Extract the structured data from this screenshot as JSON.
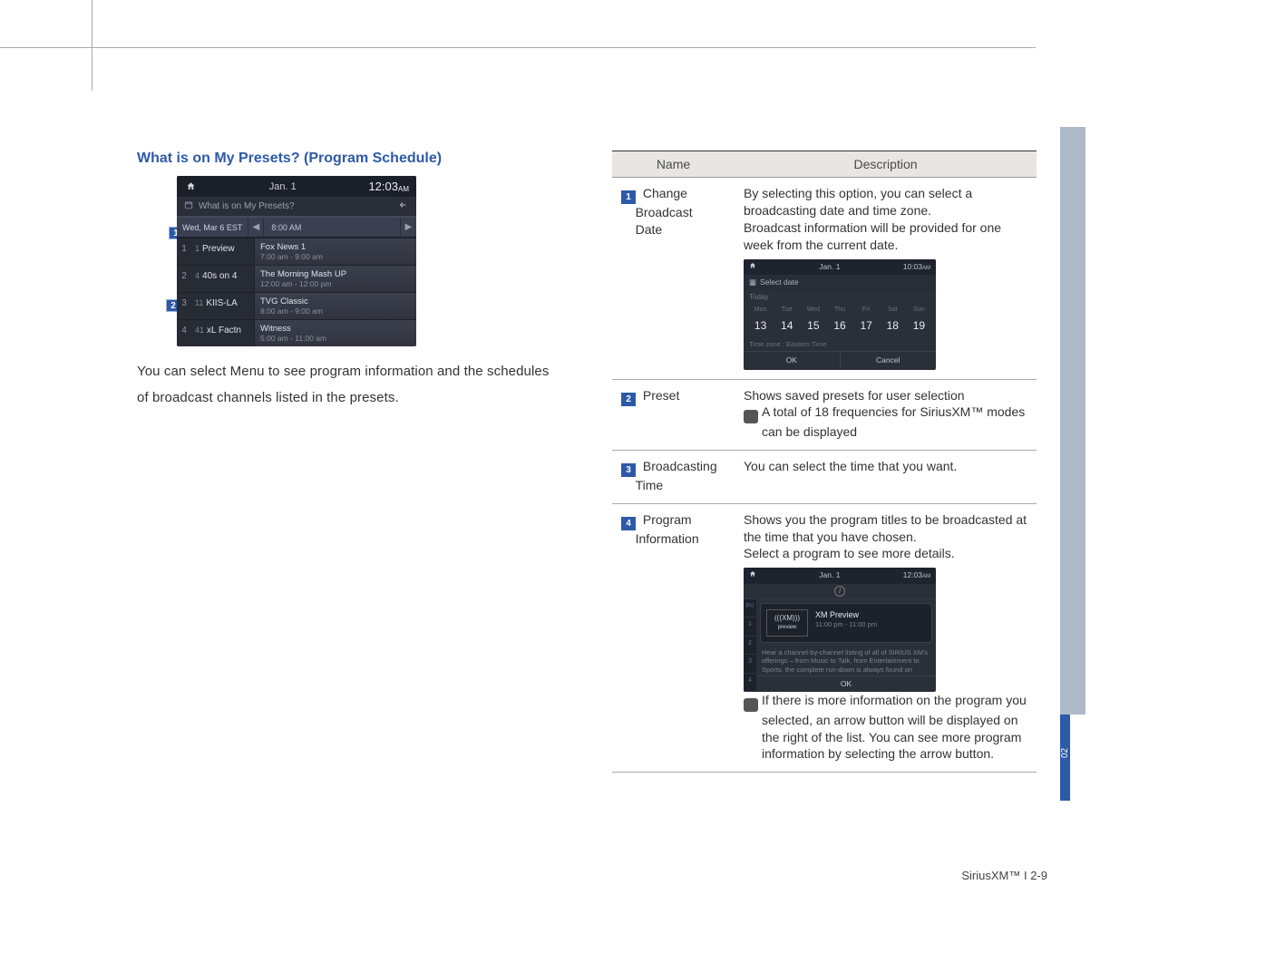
{
  "section_title": "What is on My Presets? (Program Schedule)",
  "body_paragraph": "You can select Menu to see program information and the schedules of broadcast channels listed in the presets.",
  "footer": "SiriusXM™ I 2-9",
  "tab_label": "02",
  "screenshot_main": {
    "date": "Jan.   1",
    "time": "12:03",
    "ampm": "AM",
    "screen_title": "What is on My Presets?",
    "date_selected": "Wed, Mar 6 EST",
    "time_selected": "8:00 AM",
    "rows": [
      {
        "idx": "1",
        "ch": "1",
        "preset": "Preview",
        "title": "Fox News 1",
        "sub": "7:00 am - 9:00 am"
      },
      {
        "idx": "2",
        "ch": "4",
        "preset": "40s on 4",
        "title": "The Morning Mash UP",
        "sub": "12:00 am - 12:00 pm"
      },
      {
        "idx": "3",
        "ch": "11",
        "preset": "KIIS-LA",
        "title": "TVG Classic",
        "sub": "8:00 am - 9:00 am"
      },
      {
        "idx": "4",
        "ch": "41",
        "preset": "xL Factn",
        "title": "Witness",
        "sub": "5:00 am - 11:00 am"
      }
    ]
  },
  "callouts": {
    "1": "1",
    "2": "2",
    "3": "3",
    "4": "4"
  },
  "table": {
    "headers": {
      "name": "Name",
      "desc": "Description"
    },
    "rows": [
      {
        "num": "1",
        "name": "Change Broadcast Date",
        "desc_top": "By selecting this option, you can select a broadcasting date and time zone.\nBroadcast information will be provided for one week from the current date.",
        "has_mini1": true
      },
      {
        "num": "2",
        "name": "Preset",
        "desc_top": "Shows saved presets for user selection",
        "info_note": "A total of 18 frequencies for SiriusXM™ modes can be displayed"
      },
      {
        "num": "3",
        "name": "Broadcasting Time",
        "desc_top": "You can select the time that you want."
      },
      {
        "num": "4",
        "name": "Program Information",
        "desc_top": "Shows you the program titles to be broadcasted at the time that you have chosen.\nSelect a program to see more details.",
        "has_mini2": true,
        "info_note": "If there is more information on the program you selected, an arrow button will be displayed on the right of the list. You can see more program information by selecting the arrow button."
      }
    ]
  },
  "mini1": {
    "date": "Jan.   1",
    "time": "10:03",
    "ampm": "AM",
    "title": "Select date",
    "today": "Today",
    "day_headers": [
      "Mon",
      "Tue",
      "Wed",
      "Thu",
      "Fri",
      "Sat",
      "Sun"
    ],
    "day_nums": [
      "13",
      "14",
      "15",
      "16",
      "17",
      "18",
      "19"
    ],
    "tz": "Time zone : Eastern Time",
    "ok": "OK",
    "cancel": "Cancel"
  },
  "mini2": {
    "date": "Jan.   1",
    "time": "12:03",
    "ampm": "AM",
    "logo_top": "(((XM)))",
    "logo_sub": "preview",
    "prog_title": "XM Preview",
    "prog_time": "11:00 pm - 11:00 pm",
    "desc_lines": "Hear a channel-by-channel listing of all of SIRIUS XM's offerings – from Music to Talk, from Entertainment to Sports, the complete run-down is always found on",
    "ok": "OK",
    "i_label": "i",
    "side": [
      "Fri",
      "1",
      "2",
      "3",
      "4"
    ]
  }
}
